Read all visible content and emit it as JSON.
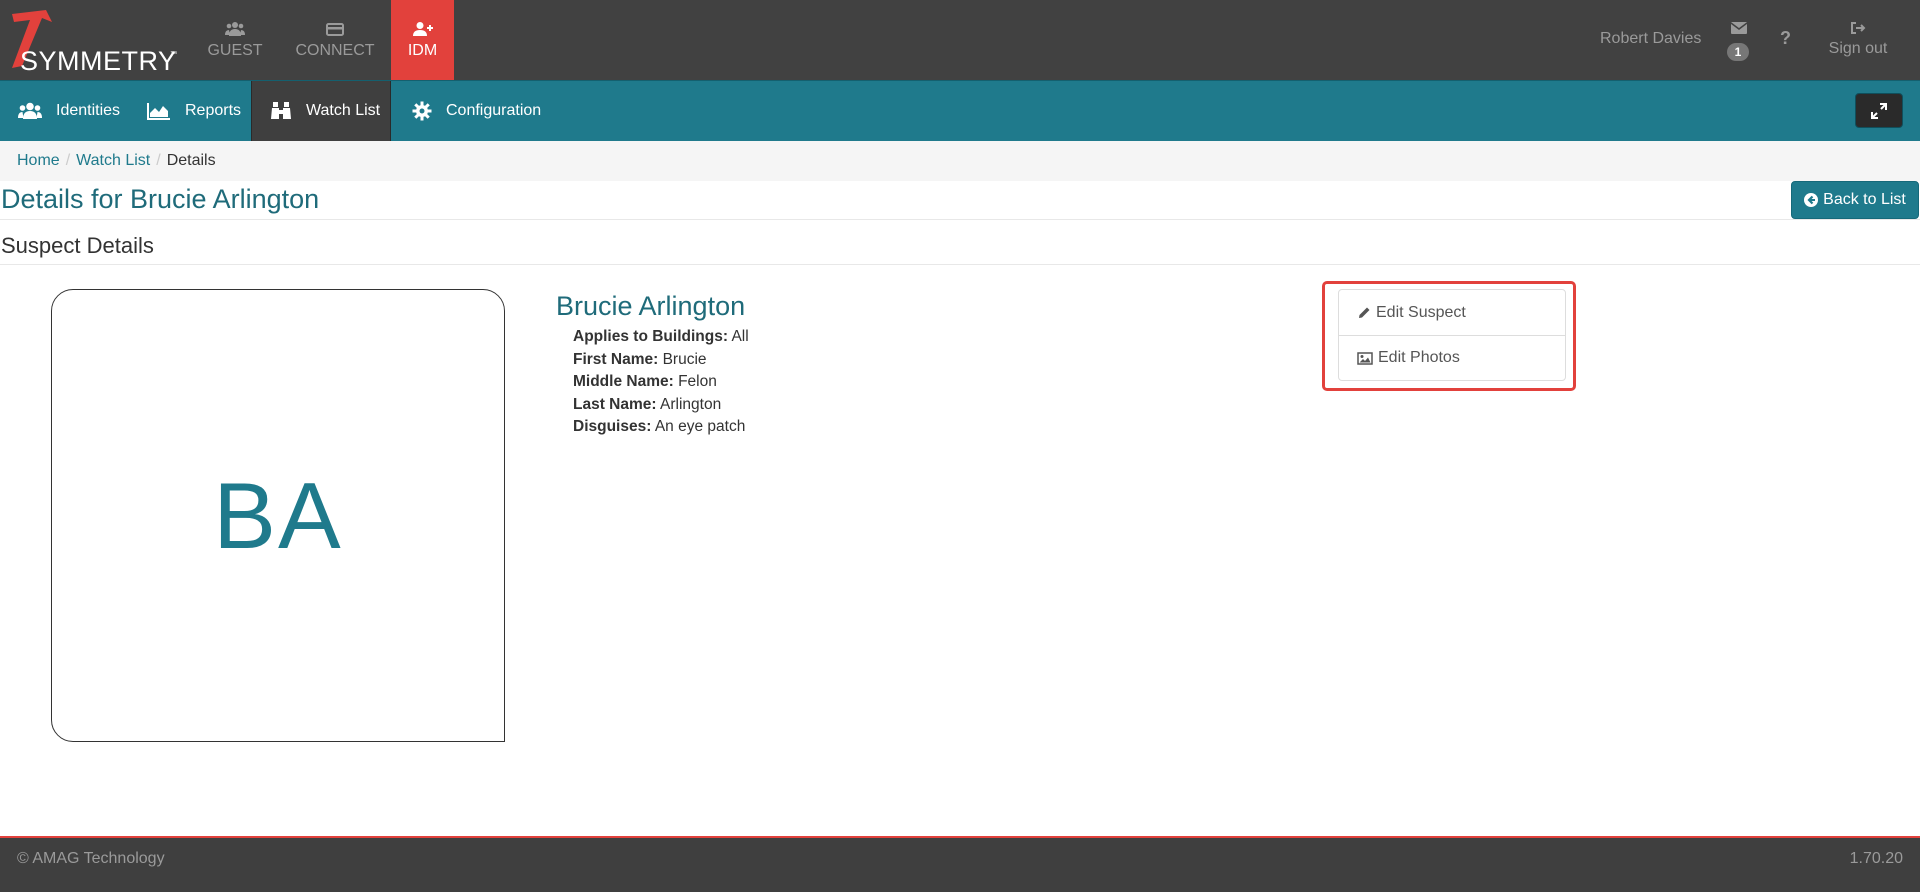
{
  "header": {
    "logo_text": "SYMMETRY",
    "logo_tm": "™",
    "apps": [
      {
        "label": "GUEST",
        "icon": "users-icon"
      },
      {
        "label": "CONNECT",
        "icon": "card-icon"
      },
      {
        "label": "IDM",
        "icon": "user-plus-icon",
        "active": true
      }
    ],
    "user_name": "Robert Davies",
    "message_count": "1",
    "help_label": "?",
    "signout_label": "Sign out"
  },
  "subnav": {
    "items": [
      {
        "label": "Identities",
        "icon": "users-icon"
      },
      {
        "label": "Reports",
        "icon": "area-chart-icon"
      },
      {
        "label": "Watch List",
        "icon": "binoculars-icon",
        "active": true
      },
      {
        "label": "Configuration",
        "icon": "gear-icon"
      }
    ]
  },
  "breadcrumb": {
    "home": "Home",
    "watch_list": "Watch List",
    "current": "Details",
    "separator": "/"
  },
  "page": {
    "title": "Details for Brucie Arlington",
    "back_label": "Back to List",
    "section_title": "Suspect Details"
  },
  "suspect": {
    "initials": "BA",
    "name": "Brucie Arlington",
    "fields": [
      {
        "label": "Applies to Buildings:",
        "value": "All"
      },
      {
        "label": "First Name:",
        "value": "Brucie"
      },
      {
        "label": "Middle Name:",
        "value": "Felon"
      },
      {
        "label": "Last Name:",
        "value": "Arlington"
      },
      {
        "label": "Disguises:",
        "value": "An eye patch"
      }
    ]
  },
  "actions": {
    "edit_suspect": "Edit Suspect",
    "edit_photos": "Edit Photos"
  },
  "footer": {
    "copyright": "© AMAG Technology",
    "version": "1.70.20"
  },
  "colors": {
    "accent_red": "#e2413c",
    "teal": "#1f7a8c",
    "dark_header": "#414141"
  }
}
